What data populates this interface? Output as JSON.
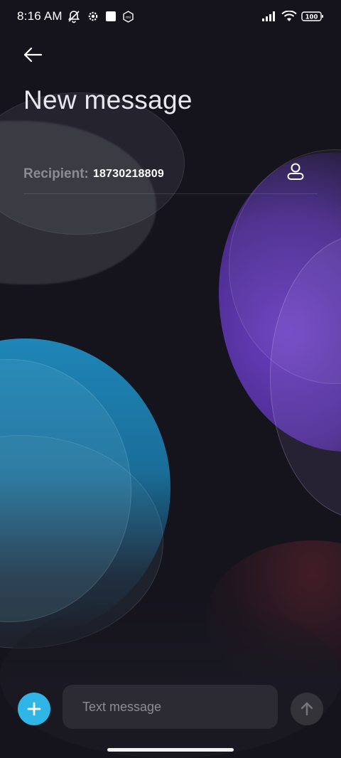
{
  "status_bar": {
    "time": "8:16 AM",
    "battery_level": "100",
    "icons_left": [
      "notifications-off-icon",
      "settings-gear-icon",
      "square-notification-icon",
      "mi-hexagon-icon"
    ],
    "icons_right": [
      "signal-icon",
      "wifi-icon",
      "battery-icon"
    ]
  },
  "header": {
    "back_icon": "back-arrow-icon",
    "title": "New message"
  },
  "recipient": {
    "label": "Recipient:",
    "value": "18730218809",
    "contact_icon": "contact-person-icon"
  },
  "composer": {
    "add_icon": "plus-icon",
    "placeholder": "Text message",
    "value": "",
    "send_icon": "send-arrow-up-icon"
  },
  "colors": {
    "background": "#15141d",
    "accent": "#2fb6e6",
    "input_bg": "#2c2b33",
    "send_bg": "#34333a"
  }
}
